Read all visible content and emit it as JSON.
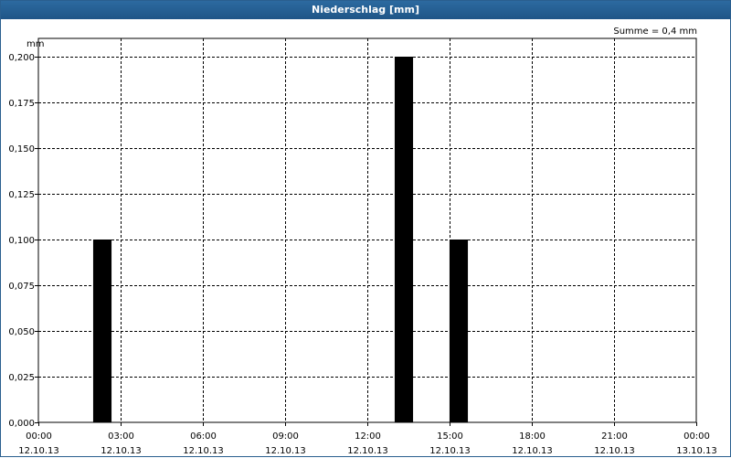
{
  "window": {
    "title": "Niederschlag [mm]"
  },
  "chart_data": {
    "type": "bar",
    "title": "Niederschlag [mm]",
    "ylabel": "mm",
    "annotation": "Summe = 0,4 mm",
    "ylim": [
      0,
      0.2
    ],
    "yticks": [
      "0,000",
      "0,025",
      "0,050",
      "0,075",
      "0,100",
      "0,125",
      "0,150",
      "0,175",
      "0,200"
    ],
    "xticks": [
      {
        "time": "00:00",
        "date": "12.10.13"
      },
      {
        "time": "03:00",
        "date": "12.10.13"
      },
      {
        "time": "06:00",
        "date": "12.10.13"
      },
      {
        "time": "09:00",
        "date": "12.10.13"
      },
      {
        "time": "12:00",
        "date": "12.10.13"
      },
      {
        "time": "15:00",
        "date": "12.10.13"
      },
      {
        "time": "18:00",
        "date": "12.10.13"
      },
      {
        "time": "21:00",
        "date": "12.10.13"
      },
      {
        "time": "00:00",
        "date": "13.10.13"
      }
    ],
    "x_range_hours": [
      0,
      24
    ],
    "bars": [
      {
        "time": "02:20",
        "value": 0.1
      },
      {
        "time": "13:20",
        "value": 0.2
      },
      {
        "time": "15:20",
        "value": 0.1
      }
    ],
    "bar_width_hours": 0.67,
    "bar_color": "#000000",
    "grid": true
  }
}
